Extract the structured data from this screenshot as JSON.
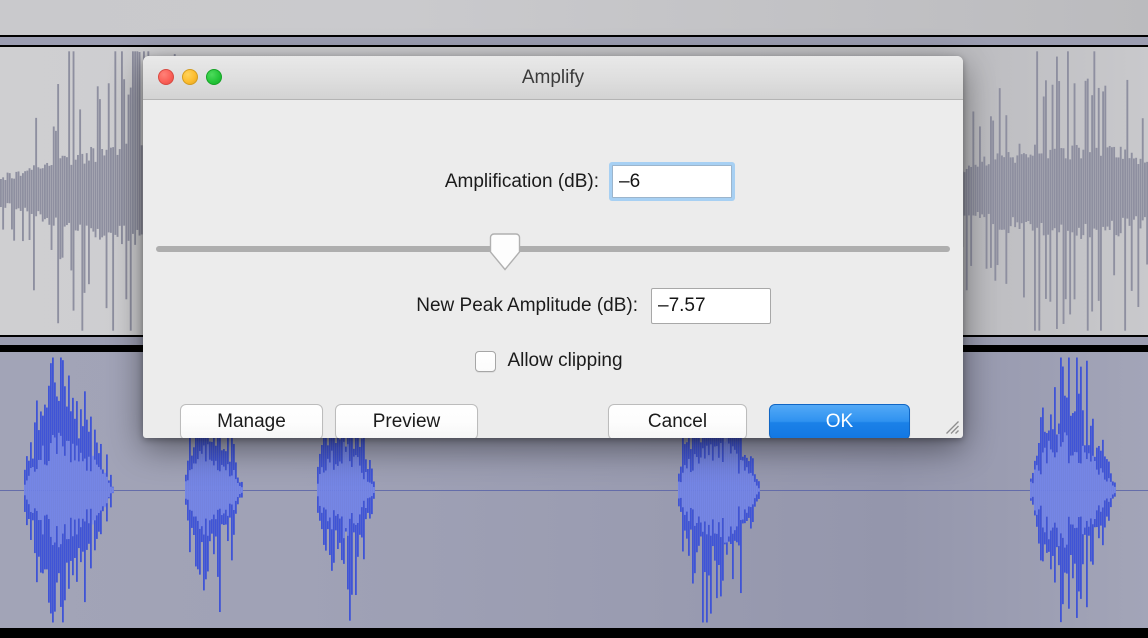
{
  "dialog": {
    "title": "Amplify",
    "window_controls": [
      {
        "name": "close",
        "color": "#fb6058"
      },
      {
        "name": "minimize",
        "color": "#fdbd2e"
      },
      {
        "name": "zoom",
        "color": "#26c63a"
      }
    ],
    "fields": [
      {
        "label": "Amplification (dB):",
        "value": "–6",
        "focused": true
      },
      {
        "label": "New Peak Amplitude (dB):",
        "value": "–7.57",
        "focused": false
      }
    ],
    "slider": {
      "name": "amplification-slider",
      "thumb_position_percent": 44,
      "track_color": "#aeaeae"
    },
    "checkbox": {
      "label": "Allow clipping",
      "checked": false
    },
    "buttons": [
      {
        "label": "Manage",
        "style": "plain"
      },
      {
        "label": "Preview",
        "style": "plain"
      },
      {
        "label": "Cancel",
        "style": "plain"
      },
      {
        "label": "OK",
        "style": "primary"
      }
    ],
    "resize_grip": true
  },
  "background": {
    "app": "audio-waveform-editor",
    "tracks": [
      {
        "name": "track-unselected",
        "selected": false,
        "waveform_color": "#8e8fa0",
        "background_color": "#cacacd"
      },
      {
        "name": "track-selected",
        "selected": true,
        "waveform_color": "#3f54d6",
        "waveform_inner_color": "#7f8fe8",
        "background_color": "#9fa1b5",
        "centerline_color": "#5b64a8"
      }
    ],
    "separator_color": "#000000",
    "selection_band_color": "#9b9db1"
  },
  "colors": {
    "dialog_bg": "#ececec",
    "titlebar_top": "#e9e9e9",
    "titlebar_bottom": "#d3d3d3",
    "accent_blue": "#2f92f0",
    "focus_ring": "#a7d0f3",
    "text": "#1b1b1b"
  }
}
